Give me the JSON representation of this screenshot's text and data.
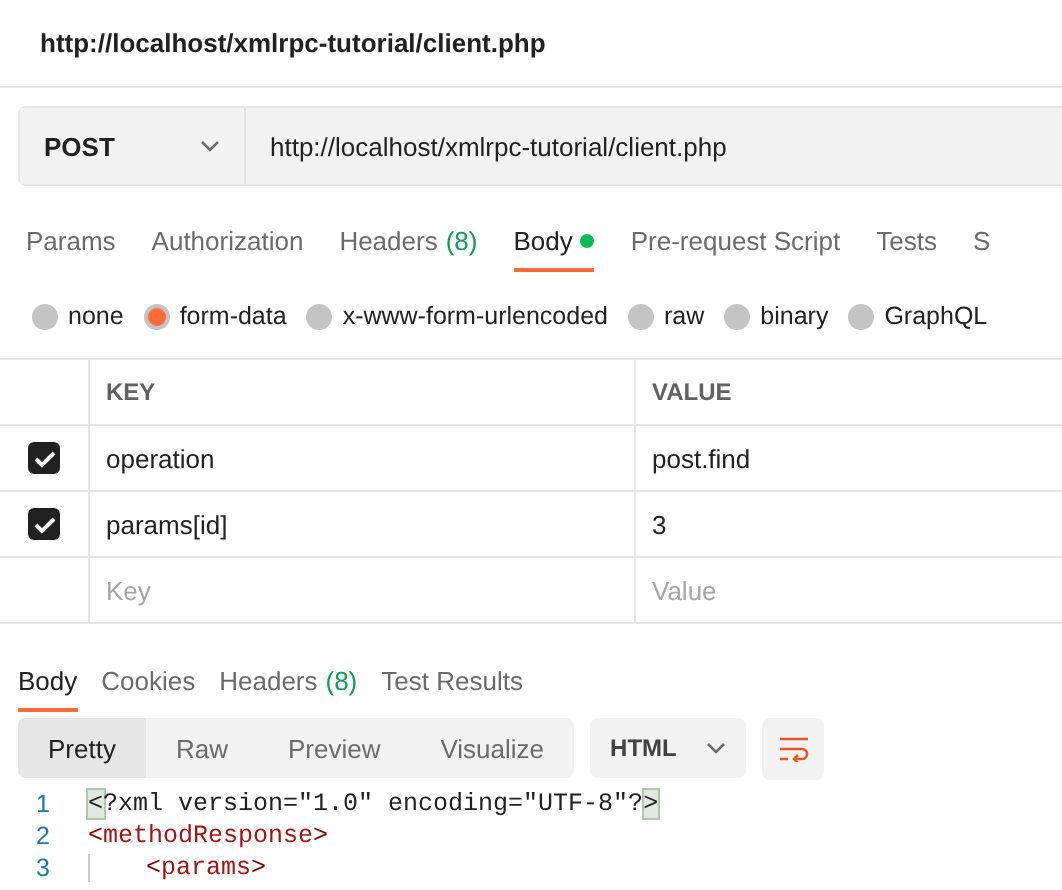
{
  "title": "http://localhost/xmlrpc-tutorial/client.php",
  "request": {
    "method": "POST",
    "url": "http://localhost/xmlrpc-tutorial/client.php"
  },
  "request_tabs": [
    {
      "label": "Params",
      "selected": false
    },
    {
      "label": "Authorization",
      "selected": false
    },
    {
      "label": "Headers",
      "count": "(8)",
      "selected": false
    },
    {
      "label": "Body",
      "dot": true,
      "selected": true
    },
    {
      "label": "Pre-request Script",
      "selected": false
    },
    {
      "label": "Tests",
      "selected": false
    },
    {
      "label": "S",
      "selected": false
    }
  ],
  "body_types": [
    {
      "label": "none",
      "selected": false
    },
    {
      "label": "form-data",
      "selected": true
    },
    {
      "label": "x-www-form-urlencoded",
      "selected": false
    },
    {
      "label": "raw",
      "selected": false
    },
    {
      "label": "binary",
      "selected": false
    },
    {
      "label": "GraphQL",
      "selected": false
    }
  ],
  "table": {
    "columns": [
      "KEY",
      "VALUE"
    ],
    "rows": [
      {
        "key": "operation",
        "value": "post.find",
        "checked": true
      },
      {
        "key": "params[id]",
        "value": "3",
        "checked": true
      }
    ],
    "new_row": {
      "key_placeholder": "Key",
      "value_placeholder": "Value"
    }
  },
  "response_tabs": [
    {
      "label": "Body",
      "selected": true
    },
    {
      "label": "Cookies",
      "selected": false
    },
    {
      "label": "Headers",
      "count": "(8)",
      "selected": false
    },
    {
      "label": "Test Results",
      "selected": false
    }
  ],
  "view_modes": [
    {
      "label": "Pretty",
      "selected": true
    },
    {
      "label": "Raw",
      "selected": false
    },
    {
      "label": "Preview",
      "selected": false
    },
    {
      "label": "Visualize",
      "selected": false
    }
  ],
  "format": "HTML",
  "code_lines": [
    {
      "number": "1",
      "indented": false,
      "tokens": [
        {
          "text": "<",
          "kind": "match"
        },
        {
          "text": "?xml version=\"1.0\" encoding=\"UTF-8\"?",
          "kind": "plain"
        },
        {
          "text": ">",
          "kind": "match"
        }
      ]
    },
    {
      "number": "2",
      "indented": false,
      "tokens": [
        {
          "text": "<",
          "kind": "punct"
        },
        {
          "text": "methodResponse",
          "kind": "tag"
        },
        {
          "text": ">",
          "kind": "punct"
        }
      ]
    },
    {
      "number": "3",
      "indented": true,
      "tokens": [
        {
          "text": "<",
          "kind": "punct"
        },
        {
          "text": "params",
          "kind": "tag"
        },
        {
          "text": ">",
          "kind": "punct"
        }
      ]
    }
  ]
}
